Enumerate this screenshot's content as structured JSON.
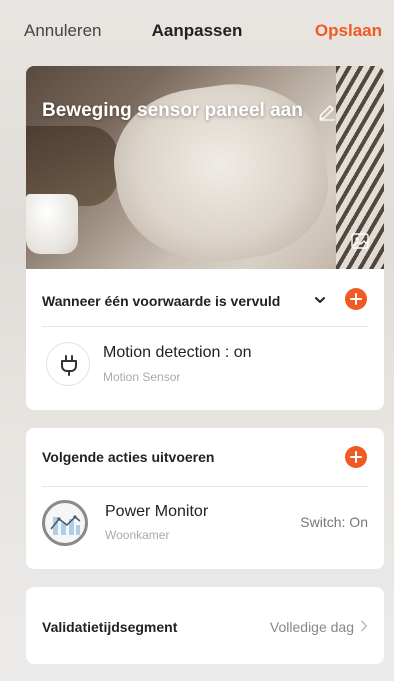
{
  "topbar": {
    "cancel_label": "Annuleren",
    "title": "Aanpassen",
    "save_label": "Opslaan"
  },
  "scene": {
    "name": "Beweging sensor paneel aan",
    "edit_icon": "pencil-icon",
    "image_icon": "image-icon"
  },
  "conditions": {
    "header": "Wanneer één voorwaarde is vervuld",
    "dropdown_icon": "chevron-down-icon",
    "add_icon": "plus-icon",
    "items": [
      {
        "title": "Motion detection : on",
        "subtitle": "Motion Sensor",
        "icon": "plug-icon"
      }
    ]
  },
  "actions": {
    "header": "Volgende acties uitvoeren",
    "add_icon": "plus-icon",
    "items": [
      {
        "title": "Power Monitor",
        "subtitle": "Woonkamer",
        "state": "Switch: On",
        "icon": "power-monitor-icon"
      }
    ]
  },
  "validity": {
    "label": "Validatietijdsegment",
    "value": "Volledige dag"
  },
  "colors": {
    "accent": "#f15a24",
    "card": "#ffffff"
  }
}
